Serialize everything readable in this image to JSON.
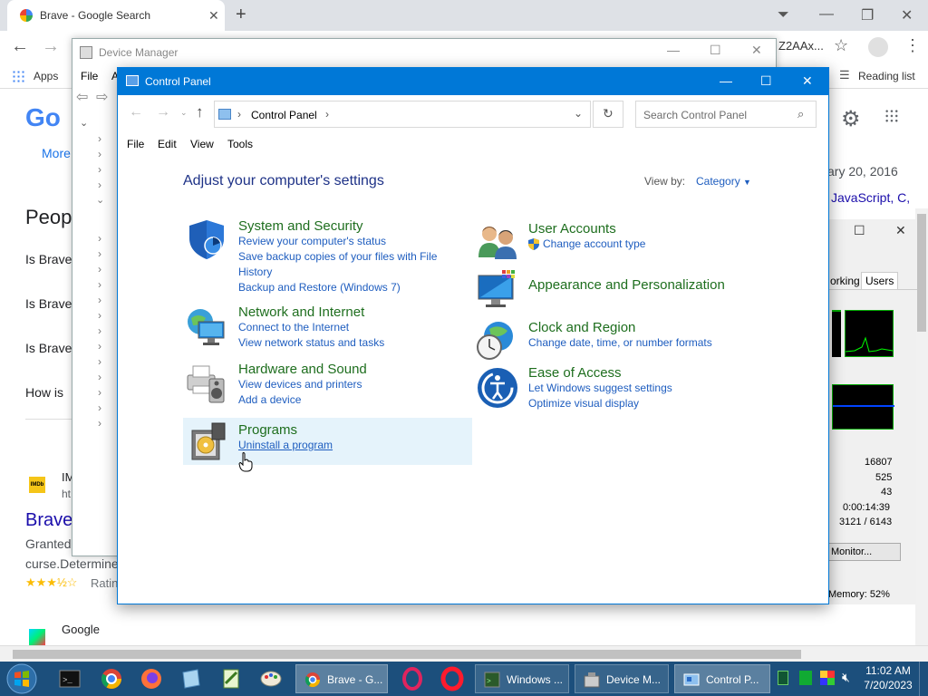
{
  "browser": {
    "tab_title": "Brave - Google Search",
    "apps_label": "Apps",
    "reading_list": "Reading list",
    "address_fragment": "Z2AAx...",
    "page_snippets": {
      "more": "More",
      "people": "Peop",
      "q1": "Is Brave",
      "q2": "Is Brave",
      "q3": "Is Brave",
      "q4": "How is",
      "imdb_label": "IMDb",
      "result_title": "Brave",
      "granted": "Granted",
      "curse": "curse.Determine",
      "rating": "Ratin",
      "google_result": "Google",
      "date": "ary 20, 2016",
      "js": "JavaScript, C,",
      "right_link": "a",
      "ht": "ht"
    }
  },
  "device_manager": {
    "title": "Device Manager",
    "menu_file": "File",
    "menu_a": "A"
  },
  "task_manager": {
    "tab_working": "orking",
    "tab_users": "Users",
    "stats": [
      "16807",
      "525",
      "43",
      "0:00:14:39",
      "3121 / 6143"
    ],
    "monitor_btn": "Monitor...",
    "memory": "Memory: 52%"
  },
  "control_panel": {
    "title": "Control Panel",
    "breadcrumb": "Control Panel",
    "search_placeholder": "Search Control Panel",
    "menu": [
      "File",
      "Edit",
      "View",
      "Tools"
    ],
    "heading": "Adjust your computer's settings",
    "view_by_label": "View by:",
    "view_by_value": "Category",
    "categories": {
      "system": {
        "title": "System and Security",
        "links": [
          "Review your computer's status",
          "Save backup copies of your files with File",
          "History",
          "Backup and Restore (Windows 7)"
        ]
      },
      "network": {
        "title": "Network and Internet",
        "links": [
          "Connect to the Internet",
          "View network status and tasks"
        ]
      },
      "hardware": {
        "title": "Hardware and Sound",
        "links": [
          "View devices and printers",
          "Add a device"
        ]
      },
      "programs": {
        "title": "Programs",
        "links": [
          "Uninstall a program"
        ]
      },
      "users": {
        "title": "User Accounts",
        "links": [
          "Change account type"
        ]
      },
      "appearance": {
        "title": "Appearance and Personalization",
        "links": []
      },
      "clock": {
        "title": "Clock and Region",
        "links": [
          "Change date, time, or number formats"
        ]
      },
      "ease": {
        "title": "Ease of Access",
        "links": [
          "Let Windows suggest settings",
          "Optimize visual display"
        ]
      }
    }
  },
  "taskbar": {
    "buttons": [
      "Brave - G...",
      "Windows ...",
      "Device M...",
      "Control P..."
    ],
    "time": "11:02 AM",
    "date": "7/20/2023"
  },
  "colors": {
    "accent": "#0078d7",
    "category_green": "#1e6e1e",
    "link_blue": "#1e5dbf",
    "heading_blue": "#1e3287",
    "taskbar": "#1c4f7c"
  }
}
